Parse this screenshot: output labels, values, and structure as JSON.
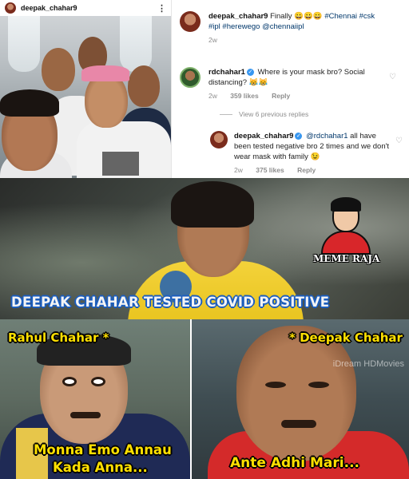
{
  "post": {
    "owner_username": "deepak_chahar9",
    "menu_icon": "⋮"
  },
  "caption": {
    "username": "deepak_chahar9",
    "text_prefix": "Finally ",
    "emojis": "😀😀😀",
    "hashtags_line1": " #Chennai #csk",
    "hashtags_line2": "#ipl #herewego @chennaiipl",
    "time": "2w"
  },
  "comment1": {
    "username": "rdchahar1",
    "text": "Where is your mask bro? Social distancing? 😹😹",
    "time": "2w",
    "likes": "359 likes",
    "reply": "Reply"
  },
  "view_previous": "View 6 previous replies",
  "comment2": {
    "username": "deepak_chahar9",
    "mention": "@rdchahar1",
    "text": " all have been tested negative bro 2 times and we don't wear mask with family 😉",
    "time": "2w",
    "likes": "375 likes",
    "reply": "Reply"
  },
  "banner": {
    "title": "DEEPAK CHAHAR TESTED COVID POSITIVE",
    "logo_text": "MEME RAJA"
  },
  "panel_left": {
    "top_caption": "Rahul Chahar *",
    "bottom_line1": "Monna Emo Annau",
    "bottom_line2": "Kada Anna..."
  },
  "panel_right": {
    "top_caption": "* Deepak Chahar",
    "watermark": "iDream HDMovies",
    "bottom_caption": "Ante Adhi Mari..."
  },
  "colors": {
    "instagram_link": "#00376b",
    "verified_blue": "#3897f0",
    "banner_outline": "#1b5dbe",
    "meme_yellow": "#ffe000",
    "jersey_yellow": "#f3d23a"
  }
}
